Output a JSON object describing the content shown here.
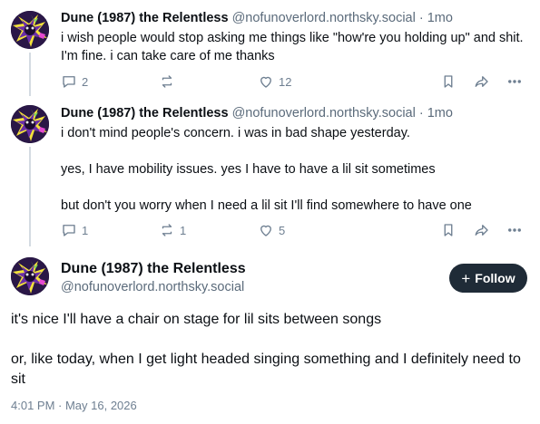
{
  "author": {
    "display_name": "Dune (1987) the Relentless",
    "handle": "@nofunoverlord.northsky.social"
  },
  "replies": [
    {
      "age": "1mo",
      "dot": "·",
      "paragraphs": [
        "i wish people would stop asking me things like \"how're you holding up\" and shit. I'm fine. i can take care of me thanks"
      ],
      "reply_count": "2",
      "repost_count": "",
      "like_count": "12"
    },
    {
      "age": "1mo",
      "dot": "·",
      "paragraphs": [
        "i don't mind people's concern. i was in bad shape yesterday.",
        "yes, I have mobility issues. yes I have to have a lil sit sometimes",
        "but don't you worry when I need a lil sit I'll find somewhere to have one"
      ],
      "reply_count": "1",
      "repost_count": "1",
      "like_count": "5"
    }
  ],
  "main_post": {
    "follow_label": "Follow",
    "paragraphs": [
      "it's nice I'll have a chair on stage for lil sits between songs",
      "or, like today, when I get light headed singing something and I definitely need to sit"
    ],
    "timestamp": "4:01 PM · May 16, 2026"
  },
  "icons": {
    "reply": "speech-bubble-icon",
    "repost": "repost-arrows-icon",
    "like": "heart-icon",
    "bookmark": "bookmark-icon",
    "share": "share-arrow-icon",
    "more": "ellipsis-icon"
  },
  "colors": {
    "follow_button_bg": "#1f2b37",
    "meta_gray": "#5b6b7b",
    "thread_line": "#d4dbe2"
  }
}
